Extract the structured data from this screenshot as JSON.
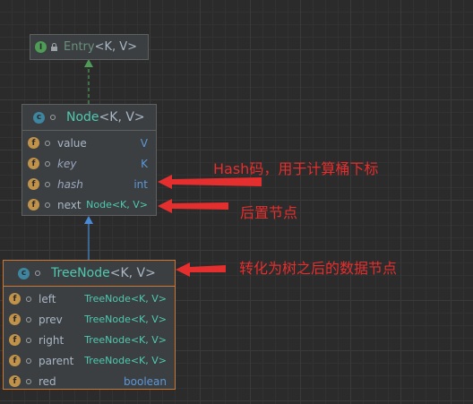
{
  "entry": {
    "title": "Entry",
    "generic": "<K, V>"
  },
  "node": {
    "title": "Node",
    "generic": "<K, V>",
    "fields": [
      {
        "name": "value",
        "type": "V",
        "italic": false
      },
      {
        "name": "key",
        "type": "K",
        "italic": true
      },
      {
        "name": "hash",
        "type": "int",
        "italic": true
      },
      {
        "name": "next",
        "type": "Node<K, V>",
        "italic": false
      }
    ]
  },
  "treenode": {
    "title": "TreeNode",
    "generic": "<K, V>",
    "fields": [
      {
        "name": "left",
        "type": "TreeNode<K, V>"
      },
      {
        "name": "prev",
        "type": "TreeNode<K, V>"
      },
      {
        "name": "right",
        "type": "TreeNode<K, V>"
      },
      {
        "name": "parent",
        "type": "TreeNode<K, V>"
      },
      {
        "name": "red",
        "type": "boolean"
      }
    ]
  },
  "annotations": {
    "hash": "Hash码，用于计算桶下标",
    "next": "后置节点",
    "treenode": "转化为树之后的数据节点"
  },
  "icons": {
    "field": "f",
    "interface": "I",
    "class": "c"
  },
  "colors": {
    "annotation": "#e52e2e",
    "tree_border": "#cc7832",
    "inherit_arrow": "#4a8ad4",
    "implements_arrow": "#4f9c57"
  }
}
